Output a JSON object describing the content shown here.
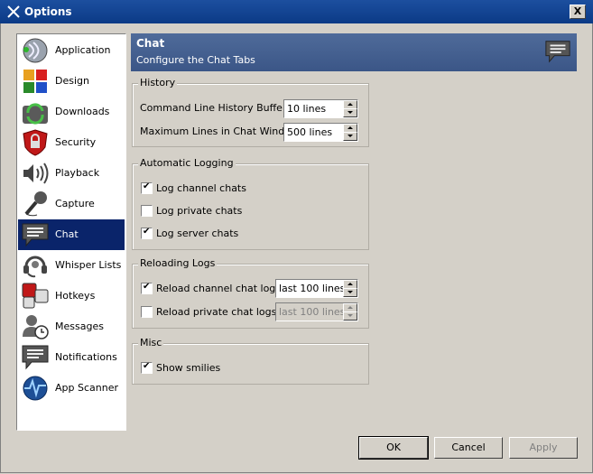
{
  "window": {
    "title": "Options",
    "close_label": "X"
  },
  "sidebar": {
    "items": [
      {
        "label": "Application",
        "icon": "application-icon"
      },
      {
        "label": "Design",
        "icon": "design-icon"
      },
      {
        "label": "Downloads",
        "icon": "downloads-icon"
      },
      {
        "label": "Security",
        "icon": "security-lock-icon"
      },
      {
        "label": "Playback",
        "icon": "speaker-icon"
      },
      {
        "label": "Capture",
        "icon": "microphone-icon"
      },
      {
        "label": "Chat",
        "icon": "chat-bubble-icon"
      },
      {
        "label": "Whisper Lists",
        "icon": "headset-icon"
      },
      {
        "label": "Hotkeys",
        "icon": "hotkeys-icon"
      },
      {
        "label": "Messages",
        "icon": "messages-clock-icon"
      },
      {
        "label": "Notifications",
        "icon": "notifications-icon"
      },
      {
        "label": "App Scanner",
        "icon": "app-scanner-icon"
      }
    ],
    "selected": "Chat"
  },
  "header": {
    "title": "Chat",
    "subtitle": "Configure the Chat Tabs"
  },
  "history": {
    "legend": "History",
    "buffer_label": "Command Line History Buffer:",
    "buffer_value": "10 lines",
    "maxlines_label": "Maximum Lines in Chat Window:",
    "maxlines_value": "500 lines"
  },
  "logging": {
    "legend": "Automatic Logging",
    "channel_label": "Log channel chats",
    "channel_checked": true,
    "private_label": "Log private chats",
    "private_checked": false,
    "server_label": "Log server chats",
    "server_checked": true
  },
  "reloading": {
    "legend": "Reloading Logs",
    "channel_label": "Reload channel chat logs",
    "channel_checked": true,
    "channel_value": "last 100 lines",
    "private_label": "Reload private chat logs",
    "private_checked": false,
    "private_value": "last 100 lines"
  },
  "misc": {
    "legend": "Misc",
    "smilies_label": "Show smilies",
    "smilies_checked": true
  },
  "buttons": {
    "ok": "OK",
    "cancel": "Cancel",
    "apply": "Apply"
  },
  "colors": {
    "selection": "#0a246a",
    "header": "#4a6696",
    "face": "#d4d0c8"
  }
}
